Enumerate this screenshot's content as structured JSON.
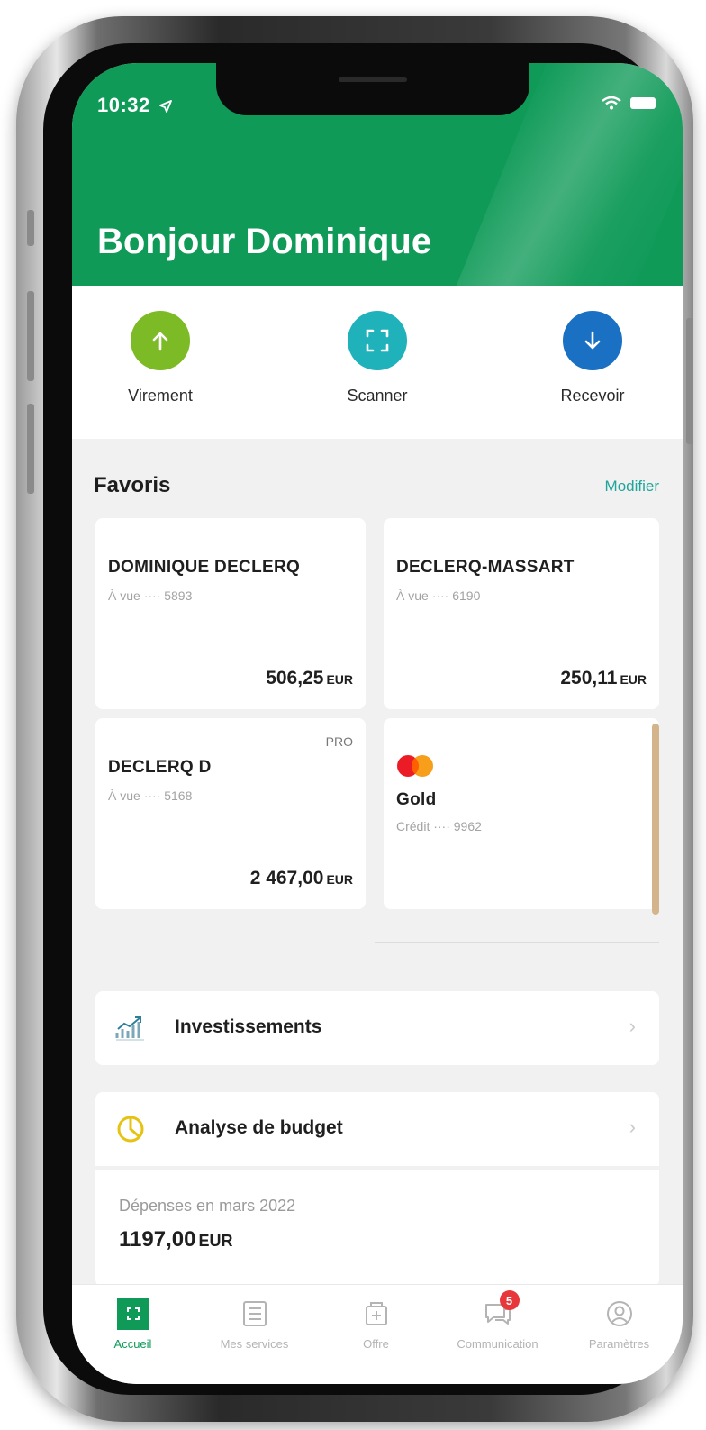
{
  "status_bar": {
    "time": "10:32"
  },
  "header": {
    "greeting": "Bonjour Dominique"
  },
  "quick_actions": [
    {
      "label": "Virement",
      "icon": "arrow-up-icon",
      "color": "#7cbb25"
    },
    {
      "label": "Scanner",
      "icon": "scan-icon",
      "color": "#1fb2bb"
    },
    {
      "label": "Recevoir",
      "icon": "arrow-down-icon",
      "color": "#1a70c2"
    }
  ],
  "favorites": {
    "title": "Favoris",
    "edit_label": "Modifier",
    "cards": [
      {
        "name": "DOMINIQUE DECLERQ",
        "sub": "À vue ···· 5893",
        "amount": "506,25",
        "currency": "EUR"
      },
      {
        "name": "DECLERQ-MASSART",
        "sub": "À vue ···· 6190",
        "amount": "250,11",
        "currency": "EUR"
      },
      {
        "name": "DECLERQ D",
        "sub": "À vue ···· 5168",
        "amount": "2 467,00",
        "currency": "EUR",
        "tag": "PRO"
      },
      {
        "name": "Gold",
        "sub": "Crédit ···· 9962"
      }
    ]
  },
  "list": {
    "investments": "Investissements",
    "budget": "Analyse de budget"
  },
  "budget": {
    "label": "Dépenses en mars 2022",
    "amount": "1197,00",
    "currency": "EUR"
  },
  "tabbar": {
    "tabs": [
      "Accueil",
      "Mes services",
      "Offre",
      "Communication",
      "Paramètres"
    ],
    "badge": "5"
  },
  "colors": {
    "brand": "#0f9a58",
    "accent_link": "#21a59a"
  }
}
